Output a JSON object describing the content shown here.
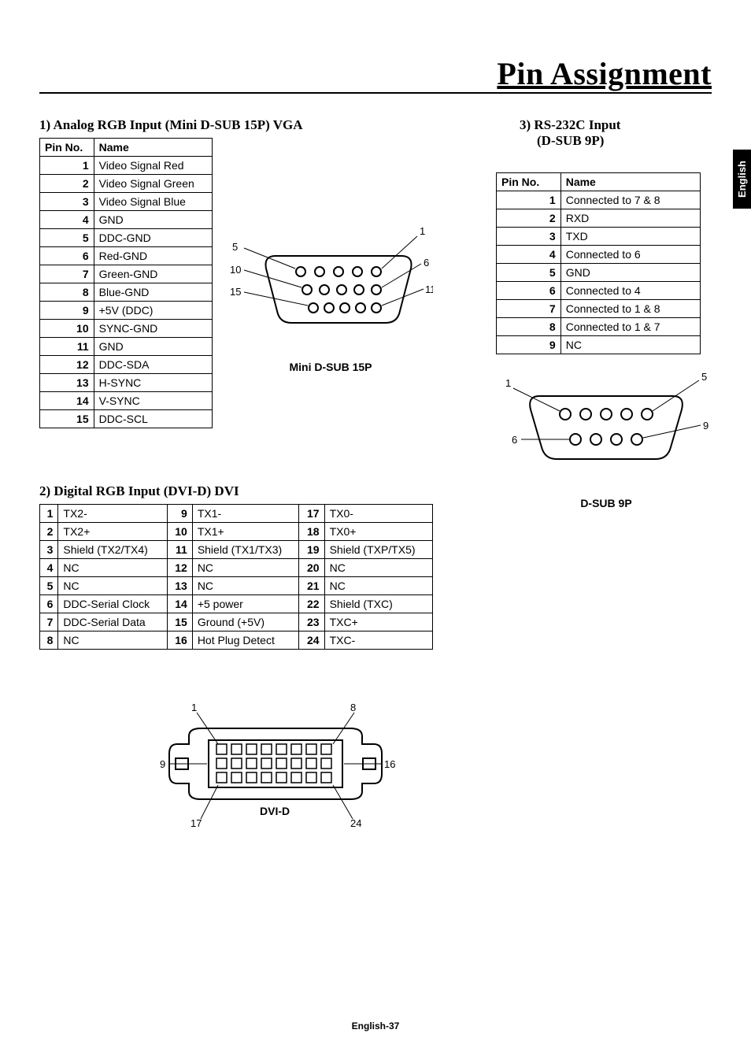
{
  "page_title": "Pin Assignment",
  "side_tab": "English",
  "footer": "English-37",
  "section1": {
    "heading": "1)  Analog RGB Input (Mini D-SUB 15P) VGA",
    "table_headers": [
      "Pin No.",
      "Name"
    ],
    "pins": [
      {
        "no": "1",
        "name": "Video Signal Red"
      },
      {
        "no": "2",
        "name": "Video Signal Green"
      },
      {
        "no": "3",
        "name": "Video Signal Blue"
      },
      {
        "no": "4",
        "name": "GND"
      },
      {
        "no": "5",
        "name": "DDC-GND"
      },
      {
        "no": "6",
        "name": "Red-GND"
      },
      {
        "no": "7",
        "name": "Green-GND"
      },
      {
        "no": "8",
        "name": "Blue-GND"
      },
      {
        "no": "9",
        "name": "+5V (DDC)"
      },
      {
        "no": "10",
        "name": "SYNC-GND"
      },
      {
        "no": "11",
        "name": "GND"
      },
      {
        "no": "12",
        "name": "DDC-SDA"
      },
      {
        "no": "13",
        "name": "H-SYNC"
      },
      {
        "no": "14",
        "name": "V-SYNC"
      },
      {
        "no": "15",
        "name": "DDC-SCL"
      }
    ],
    "diagram_caption": "Mini D-SUB 15P",
    "diagram_labels": {
      "l5": "5",
      "l10": "10",
      "l15": "15",
      "l1": "1",
      "l6": "6",
      "l11": "11"
    }
  },
  "section2": {
    "heading": "2)  Digital RGB Input (DVI-D) DVI",
    "pins": [
      {
        "no": "1",
        "name": "TX2-"
      },
      {
        "no": "9",
        "name": "TX1-"
      },
      {
        "no": "17",
        "name": "TX0-"
      },
      {
        "no": "2",
        "name": "TX2+"
      },
      {
        "no": "10",
        "name": "TX1+"
      },
      {
        "no": "18",
        "name": "TX0+"
      },
      {
        "no": "3",
        "name": "Shield (TX2/TX4)"
      },
      {
        "no": "11",
        "name": "Shield (TX1/TX3)"
      },
      {
        "no": "19",
        "name": "Shield (TXP/TX5)"
      },
      {
        "no": "4",
        "name": "NC"
      },
      {
        "no": "12",
        "name": "NC"
      },
      {
        "no": "20",
        "name": "NC"
      },
      {
        "no": "5",
        "name": "NC"
      },
      {
        "no": "13",
        "name": "NC"
      },
      {
        "no": "21",
        "name": "NC"
      },
      {
        "no": "6",
        "name": "DDC-Serial Clock"
      },
      {
        "no": "14",
        "name": "+5 power"
      },
      {
        "no": "22",
        "name": "Shield (TXC)"
      },
      {
        "no": "7",
        "name": "DDC-Serial Data"
      },
      {
        "no": "15",
        "name": "Ground (+5V)"
      },
      {
        "no": "23",
        "name": "TXC+"
      },
      {
        "no": "8",
        "name": "NC"
      },
      {
        "no": "16",
        "name": "Hot Plug Detect"
      },
      {
        "no": "24",
        "name": "TXC-"
      }
    ],
    "diagram_caption": "DVI-D",
    "diagram_labels": {
      "l1": "1",
      "l8": "8",
      "l9": "9",
      "l16": "16",
      "l17": "17",
      "l24": "24"
    }
  },
  "section3": {
    "heading_line1": "3)  RS-232C Input",
    "heading_line2": "(D-SUB 9P)",
    "table_headers": [
      "Pin No.",
      "Name"
    ],
    "pins": [
      {
        "no": "1",
        "name": "Connected to 7 & 8"
      },
      {
        "no": "2",
        "name": "RXD"
      },
      {
        "no": "3",
        "name": "TXD"
      },
      {
        "no": "4",
        "name": "Connected to 6"
      },
      {
        "no": "5",
        "name": "GND"
      },
      {
        "no": "6",
        "name": "Connected to 4"
      },
      {
        "no": "7",
        "name": "Connected to 1 & 8"
      },
      {
        "no": "8",
        "name": "Connected to 1 & 7"
      },
      {
        "no": "9",
        "name": "NC"
      }
    ],
    "diagram_caption": "D-SUB 9P",
    "diagram_labels": {
      "l1": "1",
      "l5": "5",
      "l6": "6",
      "l9": "9"
    }
  }
}
